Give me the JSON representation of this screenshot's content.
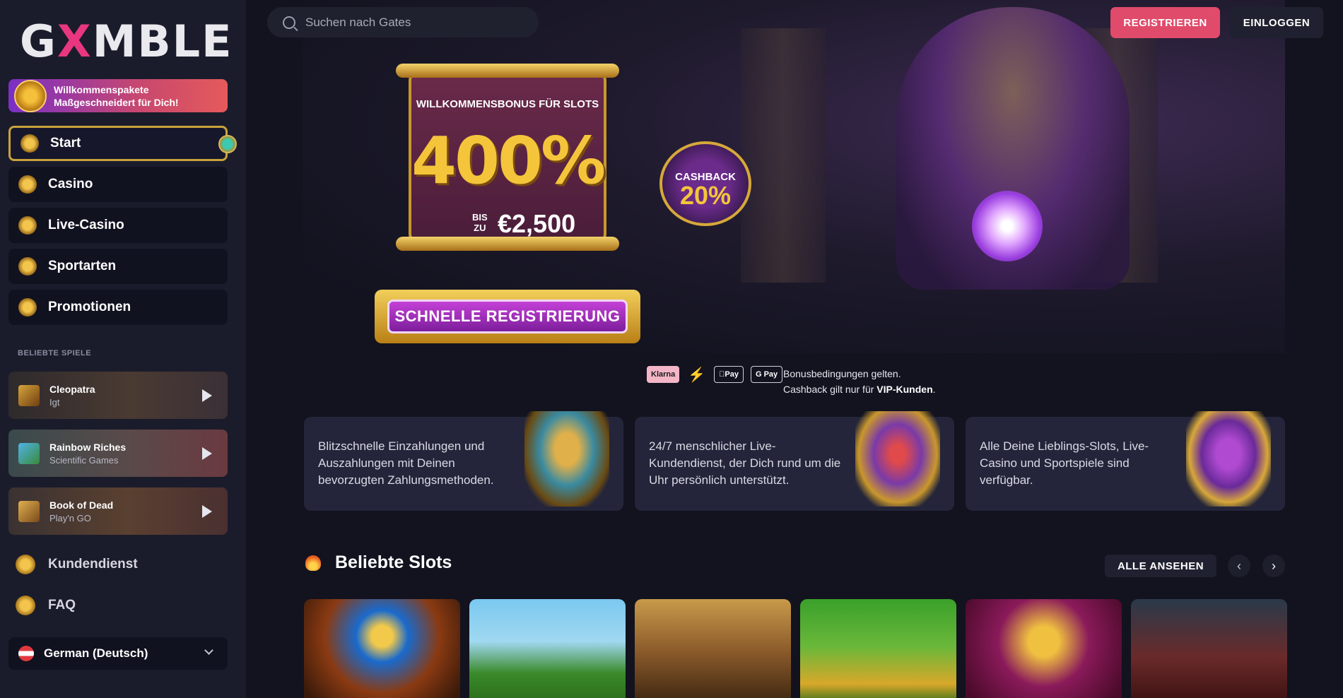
{
  "brand": {
    "logo_pre": "G",
    "logo_x": "X",
    "logo_post": "MBLE"
  },
  "sidebar": {
    "promo": {
      "line1": "Willkommenspakete",
      "line2": "Maßgeschneidert für Dich!"
    },
    "nav": [
      {
        "label": "Start",
        "icon": "pyramid-icon",
        "active": true
      },
      {
        "label": "Casino",
        "icon": "chip-icon"
      },
      {
        "label": "Live-Casino",
        "icon": "dice-icon"
      },
      {
        "label": "Sportarten",
        "icon": "ball-icon"
      },
      {
        "label": "Promotionen",
        "icon": "ankh-icon"
      }
    ],
    "section_label": "BELIEBTE SPIELE",
    "games": [
      {
        "title": "Cleopatra",
        "provider": "Igt"
      },
      {
        "title": "Rainbow Riches",
        "provider": "Scientific Games"
      },
      {
        "title": "Book of Dead",
        "provider": "Play'n GO"
      }
    ],
    "support": "Kundendienst",
    "faq": "FAQ",
    "language": "German (Deutsch)"
  },
  "topbar": {
    "search_placeholder": "Suchen nach Gates",
    "register": "REGISTRIEREN",
    "login": "EINLOGGEN"
  },
  "hero": {
    "banner_heading": "WILLKOMMENSBONUS FÜR SLOTS",
    "percent": "400%",
    "bis": "BIS",
    "zu": "ZU",
    "amount": "€2,500",
    "cashback_label": "CASHBACK",
    "cashback_value": "20%",
    "cta": "SCHNELLE REGISTRIERUNG"
  },
  "payments": {
    "klarna": "Klarna",
    "bolt": "⚡",
    "apple": "Pay",
    "gpay": "G Pay",
    "terms_line1": "Bonusbedingungen gelten.",
    "terms_line2_pre": "Cashback gilt nur für ",
    "terms_line2_bold": "VIP-Kunden",
    "terms_line2_post": "."
  },
  "features": [
    "Blitzschnelle Einzahlungen und Auszahlungen mit Deinen bevorzugten Zahlungsmethoden.",
    "24/7 menschlicher Live-Kundendienst, der Dich rund um die Uhr persönlich unterstützt.",
    "Alle Deine Lieblings-Slots, Live-Casino und Sportspiele sind verfügbar."
  ],
  "slots": {
    "heading": "Beliebte Slots",
    "see_all": "ALLE ANSEHEN",
    "prev": "‹",
    "next": "›"
  },
  "colors": {
    "accent_red": "#e04b6b",
    "gold": "#c9a23c",
    "bg": "#12131f",
    "sidebar": "#1b1c2b"
  }
}
